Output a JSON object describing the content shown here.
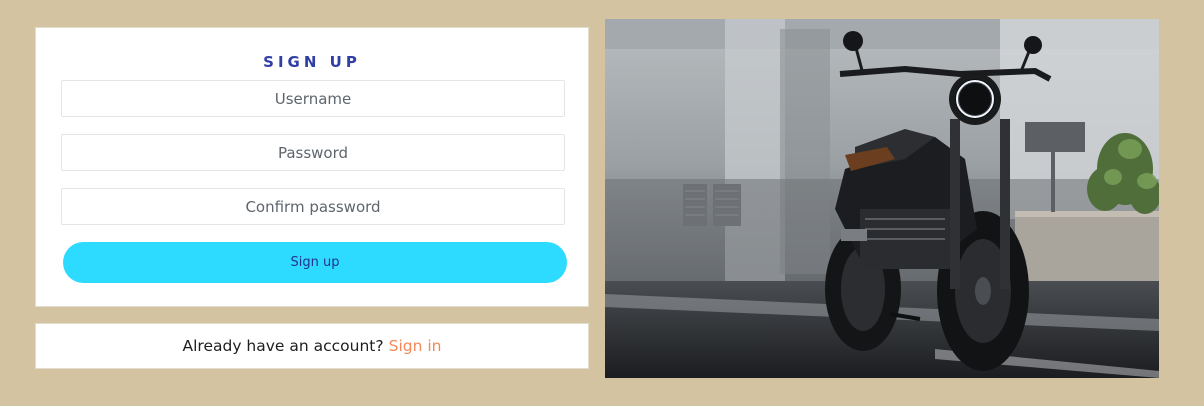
{
  "signup": {
    "title": "SIGN UP",
    "username_placeholder": "Username",
    "password_placeholder": "Password",
    "confirm_placeholder": "Confirm password",
    "button_label": "Sign up"
  },
  "signin": {
    "prompt": "Already have an account?",
    "link_label": "Sign in"
  },
  "colors": {
    "background": "#d3c3a0",
    "title": "#2f3fa5",
    "button": "#2cdbff",
    "link": "#f28a5a"
  },
  "icons": {
    "photo": "motorcycle-photo"
  }
}
